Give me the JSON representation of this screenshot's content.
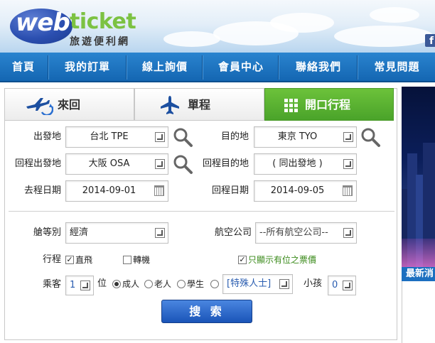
{
  "header": {
    "logo_web": "web",
    "logo_ticket": "ticket",
    "logo_sub": "旅遊便利網",
    "facebook_icon": "facebook-icon"
  },
  "nav": {
    "items": [
      "首頁",
      "我的訂單",
      "線上詢價",
      "會員中心",
      "聯絡我們",
      "常見問題"
    ]
  },
  "tabs": [
    {
      "label": "來回",
      "icon": "round-trip-plane-icon",
      "active": false
    },
    {
      "label": "單程",
      "icon": "plane-icon",
      "active": false
    },
    {
      "label": "開口行程",
      "icon": "grid-icon",
      "active": true
    }
  ],
  "form": {
    "departure_label": "出發地",
    "departure_value": "台北 TPE",
    "destination_label": "目的地",
    "destination_value": "東京 TYO",
    "return_departure_label": "回程出發地",
    "return_departure_value": "大阪 OSA",
    "return_destination_label": "回程目的地",
    "return_destination_value": "( 同出發地 )",
    "depart_date_label": "去程日期",
    "depart_date_value": "2014-09-01",
    "return_date_label": "回程日期",
    "return_date_value": "2014-09-05",
    "cabin_label": "艙等別",
    "cabin_value": "經濟",
    "airline_label": "航空公司",
    "airline_value": "--所有航空公司--",
    "itinerary_label": "行程",
    "direct_label": "直飛",
    "direct_checked": true,
    "transfer_label": "轉機",
    "transfer_checked": false,
    "available_only_label": "只顯示有位之票價",
    "available_only_checked": true,
    "passenger_label": "乘客",
    "passenger_count": "1",
    "seat_unit": "位",
    "adult_label": "成人",
    "senior_label": "老人",
    "student_label": "學生",
    "special_value": "[特殊人士]",
    "child_label": "小孩",
    "child_count": "0",
    "search_label": "搜 索"
  },
  "side": {
    "news_label": "最新消"
  },
  "colors": {
    "nav_blue": "#1a6fc0",
    "active_tab_green": "#5bb330",
    "search_button_blue": "#2a63c8",
    "logo_green": "#7cc242",
    "available_text_green": "#3a8a1a"
  }
}
